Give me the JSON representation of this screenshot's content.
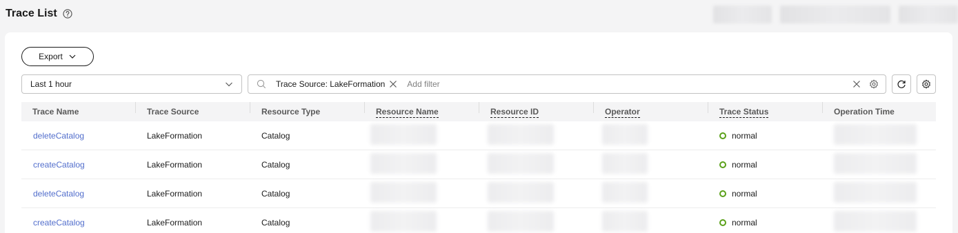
{
  "header": {
    "title": "Trace List"
  },
  "toolbar": {
    "export_label": "Export"
  },
  "time_filter": {
    "selected": "Last 1 hour"
  },
  "search": {
    "tag_label": "Trace Source: LakeFormation",
    "placeholder": "Add filter"
  },
  "table": {
    "columns": [
      "Trace Name",
      "Trace Source",
      "Resource Type",
      "Resource Name",
      "Resource ID",
      "Operator",
      "Trace Status",
      "Operation Time"
    ],
    "rows": [
      {
        "trace_name": "deleteCatalog",
        "trace_source": "LakeFormation",
        "resource_type": "Catalog",
        "trace_status": "normal"
      },
      {
        "trace_name": "createCatalog",
        "trace_source": "LakeFormation",
        "resource_type": "Catalog",
        "trace_status": "normal"
      },
      {
        "trace_name": "deleteCatalog",
        "trace_source": "LakeFormation",
        "resource_type": "Catalog",
        "trace_status": "normal"
      },
      {
        "trace_name": "createCatalog",
        "trace_source": "LakeFormation",
        "resource_type": "Catalog",
        "trace_status": "normal"
      }
    ]
  },
  "colors": {
    "link": "#526ecc",
    "status_normal": "#5aa019",
    "border": "#c2c2c2"
  },
  "icons": [
    "help-icon",
    "chevron-down-icon",
    "search-icon",
    "close-icon",
    "gear-icon",
    "refresh-icon",
    "settings-icon"
  ]
}
